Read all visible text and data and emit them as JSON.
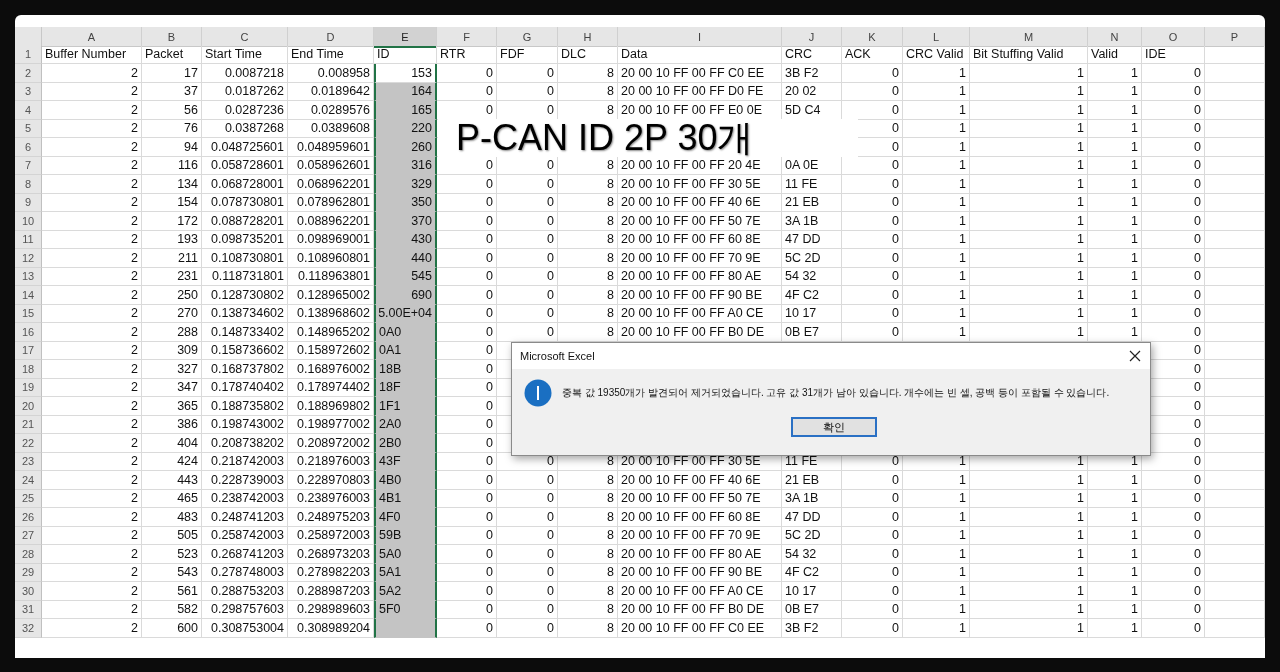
{
  "sheet": {
    "columns": [
      {
        "letter": "A",
        "kind": "number",
        "selected": false
      },
      {
        "letter": "B",
        "kind": "number",
        "selected": false
      },
      {
        "letter": "C",
        "kind": "number",
        "selected": false
      },
      {
        "letter": "D",
        "kind": "number",
        "selected": false
      },
      {
        "letter": "E",
        "kind": "mixed",
        "selected": true
      },
      {
        "letter": "F",
        "kind": "number",
        "selected": false
      },
      {
        "letter": "G",
        "kind": "number",
        "selected": false
      },
      {
        "letter": "H",
        "kind": "number",
        "selected": false
      },
      {
        "letter": "I",
        "kind": "text",
        "selected": false
      },
      {
        "letter": "J",
        "kind": "text",
        "selected": false
      },
      {
        "letter": "K",
        "kind": "number",
        "selected": false
      },
      {
        "letter": "L",
        "kind": "number",
        "selected": false
      },
      {
        "letter": "M",
        "kind": "number",
        "selected": false
      },
      {
        "letter": "N",
        "kind": "number",
        "selected": false
      },
      {
        "letter": "O",
        "kind": "number",
        "selected": false
      },
      {
        "letter": "P",
        "kind": "number",
        "selected": false
      }
    ],
    "header_row": {
      "num": "1",
      "cells": [
        "Buffer Number",
        "Packet",
        "Start Time",
        "End Time",
        "ID",
        "RTR",
        "FDF",
        "DLC",
        "Data",
        "CRC",
        "ACK",
        "CRC Valid",
        "Bit Stuffing Valid",
        "Valid",
        "IDE"
      ]
    },
    "rows": [
      {
        "num": "2",
        "active": true,
        "id_text": false,
        "cells": [
          "2",
          "17",
          "0.0087218",
          "0.008958",
          "153",
          "0",
          "0",
          "8",
          "20 00 10 FF 00 FF C0 EE",
          "3B F2",
          "0",
          "1",
          "1",
          "1",
          "0"
        ]
      },
      {
        "num": "3",
        "active": false,
        "id_text": false,
        "cells": [
          "2",
          "37",
          "0.0187262",
          "0.0189642",
          "164",
          "0",
          "0",
          "8",
          "20 00 10 FF 00 FF D0 FE",
          "20 02",
          "0",
          "1",
          "1",
          "1",
          "0"
        ]
      },
      {
        "num": "4",
        "active": false,
        "id_text": false,
        "cells": [
          "2",
          "56",
          "0.0287236",
          "0.0289576",
          "165",
          "0",
          "0",
          "8",
          "20 00 10 FF 00 FF E0 0E",
          "5D C4",
          "0",
          "1",
          "1",
          "1",
          "0"
        ]
      },
      {
        "num": "5",
        "active": false,
        "id_text": false,
        "cells": [
          "2",
          "76",
          "0.0387268",
          "0.0389608",
          "220",
          null,
          null,
          null,
          null,
          null,
          "0",
          "1",
          "1",
          "1",
          "0"
        ]
      },
      {
        "num": "6",
        "active": false,
        "id_text": false,
        "cells": [
          "2",
          "94",
          "0.048725601",
          "0.048959601",
          "260",
          null,
          null,
          null,
          null,
          null,
          "0",
          "1",
          "1",
          "1",
          "0"
        ]
      },
      {
        "num": "7",
        "active": false,
        "id_text": false,
        "cells": [
          "2",
          "116",
          "0.058728601",
          "0.058962601",
          "316",
          "0",
          "0",
          "8",
          "20 00 10 FF 00 FF 20 4E",
          "0A 0E",
          "0",
          "1",
          "1",
          "1",
          "0"
        ]
      },
      {
        "num": "8",
        "active": false,
        "id_text": false,
        "cells": [
          "2",
          "134",
          "0.068728001",
          "0.068962201",
          "329",
          "0",
          "0",
          "8",
          "20 00 10 FF 00 FF 30 5E",
          "11 FE",
          "0",
          "1",
          "1",
          "1",
          "0"
        ]
      },
      {
        "num": "9",
        "active": false,
        "id_text": false,
        "cells": [
          "2",
          "154",
          "0.078730801",
          "0.078962801",
          "350",
          "0",
          "0",
          "8",
          "20 00 10 FF 00 FF 40 6E",
          "21 EB",
          "0",
          "1",
          "1",
          "1",
          "0"
        ]
      },
      {
        "num": "10",
        "active": false,
        "id_text": false,
        "cells": [
          "2",
          "172",
          "0.088728201",
          "0.088962201",
          "370",
          "0",
          "0",
          "8",
          "20 00 10 FF 00 FF 50 7E",
          "3A 1B",
          "0",
          "1",
          "1",
          "1",
          "0"
        ]
      },
      {
        "num": "11",
        "active": false,
        "id_text": false,
        "cells": [
          "2",
          "193",
          "0.098735201",
          "0.098969001",
          "430",
          "0",
          "0",
          "8",
          "20 00 10 FF 00 FF 60 8E",
          "47 DD",
          "0",
          "1",
          "1",
          "1",
          "0"
        ]
      },
      {
        "num": "12",
        "active": false,
        "id_text": false,
        "cells": [
          "2",
          "211",
          "0.108730801",
          "0.108960801",
          "440",
          "0",
          "0",
          "8",
          "20 00 10 FF 00 FF 70 9E",
          "5C 2D",
          "0",
          "1",
          "1",
          "1",
          "0"
        ]
      },
      {
        "num": "13",
        "active": false,
        "id_text": false,
        "cells": [
          "2",
          "231",
          "0.118731801",
          "0.118963801",
          "545",
          "0",
          "0",
          "8",
          "20 00 10 FF 00 FF 80 AE",
          "54 32",
          "0",
          "1",
          "1",
          "1",
          "0"
        ]
      },
      {
        "num": "14",
        "active": false,
        "id_text": false,
        "cells": [
          "2",
          "250",
          "0.128730802",
          "0.128965002",
          "690",
          "0",
          "0",
          "8",
          "20 00 10 FF 00 FF 90 BE",
          "4F C2",
          "0",
          "1",
          "1",
          "1",
          "0"
        ]
      },
      {
        "num": "15",
        "active": false,
        "id_text": false,
        "cells": [
          "2",
          "270",
          "0.138734602",
          "0.138968602",
          "5.00E+04",
          "0",
          "0",
          "8",
          "20 00 10 FF 00 FF A0 CE",
          "10 17",
          "0",
          "1",
          "1",
          "1",
          "0"
        ]
      },
      {
        "num": "16",
        "active": false,
        "id_text": true,
        "cells": [
          "2",
          "288",
          "0.148733402",
          "0.148965202",
          "0A0",
          "0",
          "0",
          "8",
          "20 00 10 FF 00 FF B0 DE",
          "0B E7",
          "0",
          "1",
          "1",
          "1",
          "0"
        ]
      },
      {
        "num": "17",
        "active": false,
        "id_text": true,
        "cells": [
          "2",
          "309",
          "0.158736602",
          "0.158972602",
          "0A1",
          "0",
          null,
          null,
          null,
          null,
          null,
          null,
          null,
          null,
          "0"
        ]
      },
      {
        "num": "18",
        "active": false,
        "id_text": true,
        "cells": [
          "2",
          "327",
          "0.168737802",
          "0.168976002",
          "18B",
          "0",
          null,
          null,
          null,
          null,
          null,
          null,
          null,
          null,
          "0"
        ]
      },
      {
        "num": "19",
        "active": false,
        "id_text": true,
        "cells": [
          "2",
          "347",
          "0.178740402",
          "0.178974402",
          "18F",
          "0",
          null,
          null,
          null,
          null,
          null,
          null,
          null,
          null,
          "0"
        ]
      },
      {
        "num": "20",
        "active": false,
        "id_text": true,
        "cells": [
          "2",
          "365",
          "0.188735802",
          "0.188969802",
          "1F1",
          "0",
          null,
          null,
          null,
          null,
          null,
          null,
          null,
          null,
          "0"
        ]
      },
      {
        "num": "21",
        "active": false,
        "id_text": true,
        "cells": [
          "2",
          "386",
          "0.198743002",
          "0.198977002",
          "2A0",
          "0",
          null,
          null,
          null,
          null,
          null,
          null,
          null,
          null,
          "0"
        ]
      },
      {
        "num": "22",
        "active": false,
        "id_text": true,
        "cells": [
          "2",
          "404",
          "0.208738202",
          "0.208972002",
          "2B0",
          "0",
          null,
          null,
          null,
          null,
          null,
          null,
          null,
          null,
          "0"
        ]
      },
      {
        "num": "23",
        "active": false,
        "id_text": true,
        "cells": [
          "2",
          "424",
          "0.218742003",
          "0.218976003",
          "43F",
          "0",
          "0",
          "8",
          "20 00 10 FF 00 FF 30 5E",
          "11 FE",
          "0",
          "1",
          "1",
          "1",
          "0"
        ]
      },
      {
        "num": "24",
        "active": false,
        "id_text": true,
        "cells": [
          "2",
          "443",
          "0.228739003",
          "0.228970803",
          "4B0",
          "0",
          "0",
          "8",
          "20 00 10 FF 00 FF 40 6E",
          "21 EB",
          "0",
          "1",
          "1",
          "1",
          "0"
        ]
      },
      {
        "num": "25",
        "active": false,
        "id_text": true,
        "cells": [
          "2",
          "465",
          "0.238742003",
          "0.238976003",
          "4B1",
          "0",
          "0",
          "8",
          "20 00 10 FF 00 FF 50 7E",
          "3A 1B",
          "0",
          "1",
          "1",
          "1",
          "0"
        ]
      },
      {
        "num": "26",
        "active": false,
        "id_text": true,
        "cells": [
          "2",
          "483",
          "0.248741203",
          "0.248975203",
          "4F0",
          "0",
          "0",
          "8",
          "20 00 10 FF 00 FF 60 8E",
          "47 DD",
          "0",
          "1",
          "1",
          "1",
          "0"
        ]
      },
      {
        "num": "27",
        "active": false,
        "id_text": true,
        "cells": [
          "2",
          "505",
          "0.258742003",
          "0.258972003",
          "59B",
          "0",
          "0",
          "8",
          "20 00 10 FF 00 FF 70 9E",
          "5C 2D",
          "0",
          "1",
          "1",
          "1",
          "0"
        ]
      },
      {
        "num": "28",
        "active": false,
        "id_text": true,
        "cells": [
          "2",
          "523",
          "0.268741203",
          "0.268973203",
          "5A0",
          "0",
          "0",
          "8",
          "20 00 10 FF 00 FF 80 AE",
          "54 32",
          "0",
          "1",
          "1",
          "1",
          "0"
        ]
      },
      {
        "num": "29",
        "active": false,
        "id_text": true,
        "cells": [
          "2",
          "543",
          "0.278748003",
          "0.278982203",
          "5A1",
          "0",
          "0",
          "8",
          "20 00 10 FF 00 FF 90 BE",
          "4F C2",
          "0",
          "1",
          "1",
          "1",
          "0"
        ]
      },
      {
        "num": "30",
        "active": false,
        "id_text": true,
        "cells": [
          "2",
          "561",
          "0.288753203",
          "0.288987203",
          "5A2",
          "0",
          "0",
          "8",
          "20 00 10 FF 00 FF A0 CE",
          "10 17",
          "0",
          "1",
          "1",
          "1",
          "0"
        ]
      },
      {
        "num": "31",
        "active": false,
        "id_text": true,
        "cells": [
          "2",
          "582",
          "0.298757603",
          "0.298989603",
          "5F0",
          "0",
          "0",
          "8",
          "20 00 10 FF 00 FF B0 DE",
          "0B E7",
          "0",
          "1",
          "1",
          "1",
          "0"
        ]
      },
      {
        "num": "32",
        "active": false,
        "cells": [
          "2",
          "600",
          "0.308753004",
          "0.308989204",
          null,
          "0",
          "0",
          "8",
          "20 00 10 FF 00 FF C0 EE",
          "3B F2",
          "0",
          "1",
          "1",
          "1",
          "0"
        ]
      }
    ]
  },
  "caption": {
    "text": "P-CAN ID 2P 30개"
  },
  "dialog": {
    "title": "Microsoft Excel",
    "message": "중복 값 19350개가 발견되어 제거되었습니다. 고유 값 31개가 남아 있습니다. 개수에는 빈 셀, 공백 등이 포함될 수 있습니다.",
    "button": "확인"
  }
}
